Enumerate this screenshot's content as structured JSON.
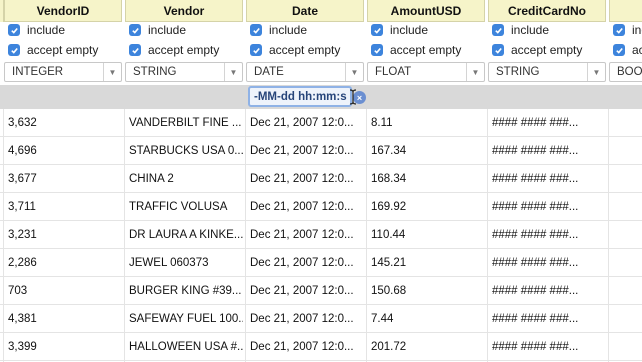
{
  "columns": [
    {
      "name": "VendorID",
      "include_label": "include",
      "accept_empty_label": "accept empty",
      "type": "INTEGER"
    },
    {
      "name": "Vendor",
      "include_label": "include",
      "accept_empty_label": "accept empty",
      "type": "STRING"
    },
    {
      "name": "Date",
      "include_label": "include",
      "accept_empty_label": "accept empty",
      "type": "DATE"
    },
    {
      "name": "AmountUSD",
      "include_label": "include",
      "accept_empty_label": "accept empty",
      "type": "FLOAT"
    },
    {
      "name": "CreditCardNo",
      "include_label": "include",
      "accept_empty_label": "accept empty",
      "type": "STRING"
    },
    {
      "name": "",
      "include_label": "inc",
      "accept_empty_label": "ac",
      "type": "BOO"
    }
  ],
  "date_format_value": "-MM-dd hh:mm:s",
  "clear_icon_glyph": "×",
  "rows": [
    [
      "3,632",
      "VANDERBILT FINE ...",
      "Dec 21, 2007 12:0...",
      "8.11",
      "#### #### ###..."
    ],
    [
      "4,696",
      "STARBUCKS USA 0...",
      "Dec 21, 2007 12:0...",
      "167.34",
      "#### #### ###..."
    ],
    [
      "3,677",
      "CHINA 2",
      "Dec 21, 2007 12:0...",
      "168.34",
      "#### #### ###..."
    ],
    [
      "3,711",
      "TRAFFIC VOLUSA",
      "Dec 21, 2007 12:0...",
      "169.92",
      "#### #### ###..."
    ],
    [
      "3,231",
      "DR LAURA A KINKE...",
      "Dec 21, 2007 12:0...",
      "110.44",
      "#### #### ###..."
    ],
    [
      "2,286",
      "JEWEL 060373",
      "Dec 21, 2007 12:0...",
      "145.21",
      "#### #### ###..."
    ],
    [
      "703",
      "BURGER KING #39...",
      "Dec 21, 2007 12:0...",
      "150.68",
      "#### #### ###..."
    ],
    [
      "4,381",
      "SAFEWAY FUEL 100...",
      "Dec 21, 2007 12:0...",
      "7.44",
      "#### #### ###..."
    ],
    [
      "3,399",
      "HALLOWEEN USA #...",
      "Dec 21, 2007 12:0...",
      "201.72",
      "#### #### ###..."
    ]
  ],
  "colors": {
    "header_bg": "#f6f4c9",
    "checkbox_blue": "#3d84dc",
    "format_band": "#d9d9d9",
    "format_input_border": "#8fb2e6"
  }
}
